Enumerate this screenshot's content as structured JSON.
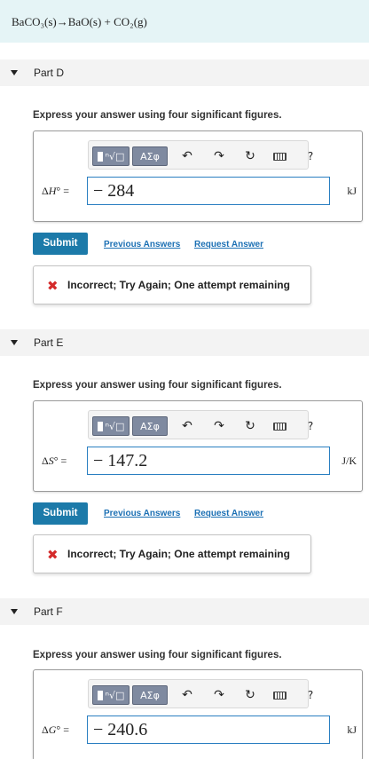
{
  "equation": "BaCO₃(s)→BaO(s) + CO₂(g)",
  "ui": {
    "instruction": "Express your answer using four significant figures.",
    "submit_label": "Submit",
    "previous_answers": "Previous Answers",
    "request_answer": "Request Answer",
    "feedback": "Incorrect; Try Again; One attempt remaining",
    "symbols_label": "ΑΣφ",
    "help_label": "?"
  },
  "icons": {
    "undo": "undo-arrow",
    "redo": "redo-arrow",
    "reset": "circular-refresh",
    "keyboard": "keyboard",
    "incorrect": "red-x"
  },
  "colors": {
    "equation_bg": "#e5f4f6",
    "submit_bg": "#1c7aa9",
    "link": "#1c70b4",
    "incorrect": "#d42b2b"
  },
  "parts": [
    {
      "label": "Part D",
      "answer_symbol": "H",
      "answer": "− 284",
      "unit": "kJ"
    },
    {
      "label": "Part E",
      "answer_symbol": "S",
      "answer": "− 147.2",
      "unit": "J/K"
    },
    {
      "label": "Part F",
      "answer_symbol": "G",
      "answer": "− 240.6",
      "unit": "kJ"
    }
  ]
}
